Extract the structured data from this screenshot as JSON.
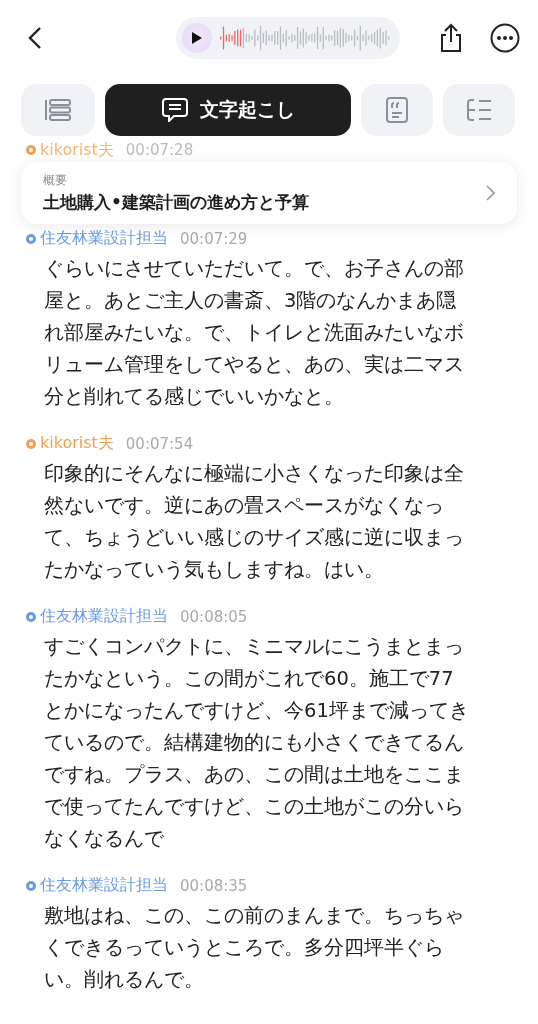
{
  "tabs": [
    {
      "kind": "list",
      "selected": false
    },
    {
      "kind": "transcript",
      "selected": true,
      "label": "文字起こし"
    },
    {
      "kind": "quote",
      "selected": false
    },
    {
      "kind": "outline",
      "selected": false
    }
  ],
  "peek_entry": {
    "speaker": "kikorist夫",
    "time": "00:07:28",
    "color": "#f0a050"
  },
  "summary": {
    "label": "概要",
    "title": "土地購入•建築計画の進め方と予算"
  },
  "entries": [
    {
      "speaker": "住友林業設計担当",
      "time": "00:07:29",
      "color": "#6a9be0",
      "text": "ぐらいにさせていただいて。で、お子さんの部屋と。あとご主人の書斎、3階のなんかまあ隠れ部屋みたいな。で、トイレと洗面みたいなボリューム管理をしてやると、あの、実は二マス分と削れてる感じでいいかなと。"
    },
    {
      "speaker": "kikorist夫",
      "time": "00:07:54",
      "color": "#f0a050",
      "text": "印象的にそんなに極端に小さくなった印象は全然ないです。逆にあの畳スペースがなくなって、ちょうどいい感じのサイズ感に逆に収まったかなっていう気もしますね。はい。"
    },
    {
      "speaker": "住友林業設計担当",
      "time": "00:08:05",
      "color": "#6a9be0",
      "text": "すごくコンパクトに、ミニマルにこうまとまったかなという。この間がこれで60。施工で77とかになったんですけど、今61坪まで減ってきているので。結構建物的にも小さくできてるんですね。プラス、あの、この間は土地をここまで使ってたんですけど、この土地がこの分いらなくなるんで"
    },
    {
      "speaker": "住友林業設計担当",
      "time": "00:08:35",
      "color": "#6a9be0",
      "text": "敷地はね、この、この前のまんまで。ちっちゃくできるっていうところで。多分四坪半ぐらい。削れるんで。"
    }
  ]
}
